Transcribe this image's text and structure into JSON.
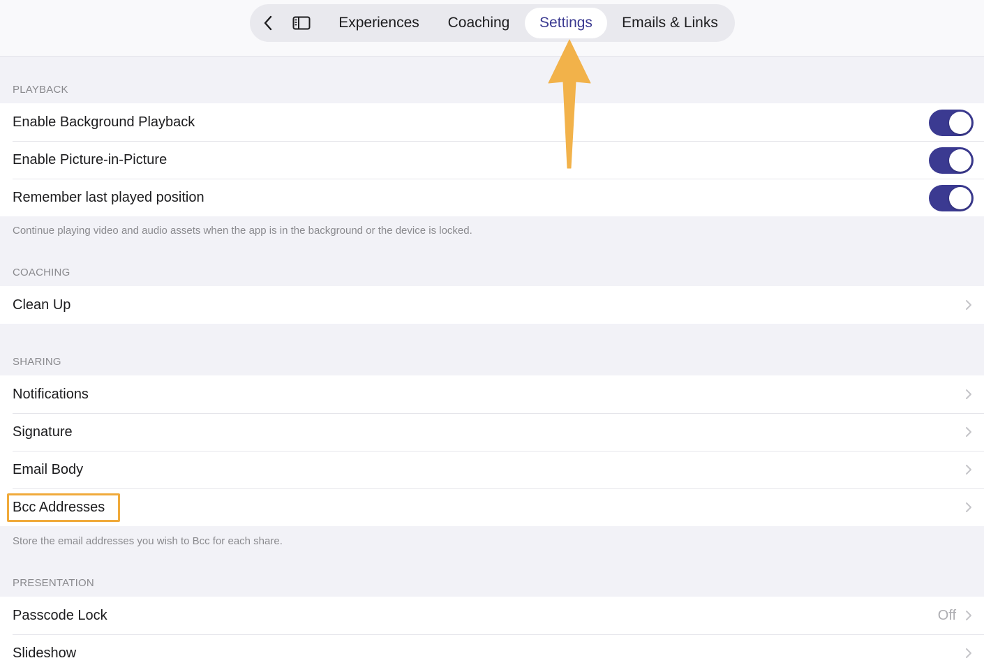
{
  "nav": {
    "back_icon": "chevron-left-icon",
    "sidebar_icon": "sidebar-toggle-icon",
    "tabs": [
      {
        "label": "Experiences",
        "selected": false
      },
      {
        "label": "Coaching",
        "selected": false
      },
      {
        "label": "Settings",
        "selected": true
      },
      {
        "label": "Emails & Links",
        "selected": false
      }
    ]
  },
  "colors": {
    "accent": "#3b3a91",
    "highlight": "#f0aa3b",
    "background": "#f2f2f7"
  },
  "playback": {
    "header": "PLAYBACK",
    "rows": [
      {
        "label": "Enable Background Playback",
        "toggle": true
      },
      {
        "label": "Enable Picture-in-Picture",
        "toggle": true
      },
      {
        "label": "Remember last played position",
        "toggle": true
      }
    ],
    "footer": "Continue playing video and audio assets when the app is in the background or the device is locked."
  },
  "coaching": {
    "header": "COACHING",
    "rows": [
      {
        "label": "Clean Up"
      }
    ]
  },
  "sharing": {
    "header": "SHARING",
    "rows": [
      {
        "label": "Notifications"
      },
      {
        "label": "Signature"
      },
      {
        "label": "Email Body"
      },
      {
        "label": "Bcc Addresses",
        "highlighted": true
      }
    ],
    "footer": "Store the email addresses you wish to Bcc for each share."
  },
  "presentation": {
    "header": "PRESENTATION",
    "rows": [
      {
        "label": "Passcode Lock",
        "detail": "Off"
      },
      {
        "label": "Slideshow"
      }
    ]
  }
}
